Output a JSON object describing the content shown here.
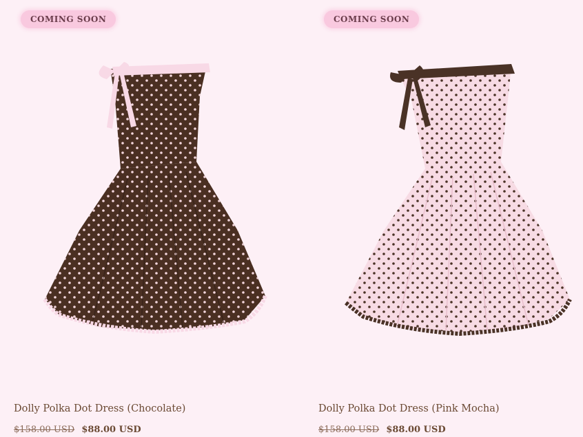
{
  "products": [
    {
      "badge": "COMING SOON",
      "title": "Dolly Polka Dot Dress (Chocolate)",
      "compare_price": "$158.00 USD",
      "sale_price": "$88.00 USD",
      "dress_color": "#4a2f22",
      "dot_color": "#f3d6dc",
      "accent_color": "#f8d9e6"
    },
    {
      "badge": "COMING SOON",
      "title": "Dolly Polka Dot Dress (Pink Mocha)",
      "compare_price": "$158.00 USD",
      "sale_price": "$88.00 USD",
      "dress_color": "#f7dbe4",
      "dot_color": "#4a3226",
      "accent_color": "#4a3226"
    }
  ]
}
